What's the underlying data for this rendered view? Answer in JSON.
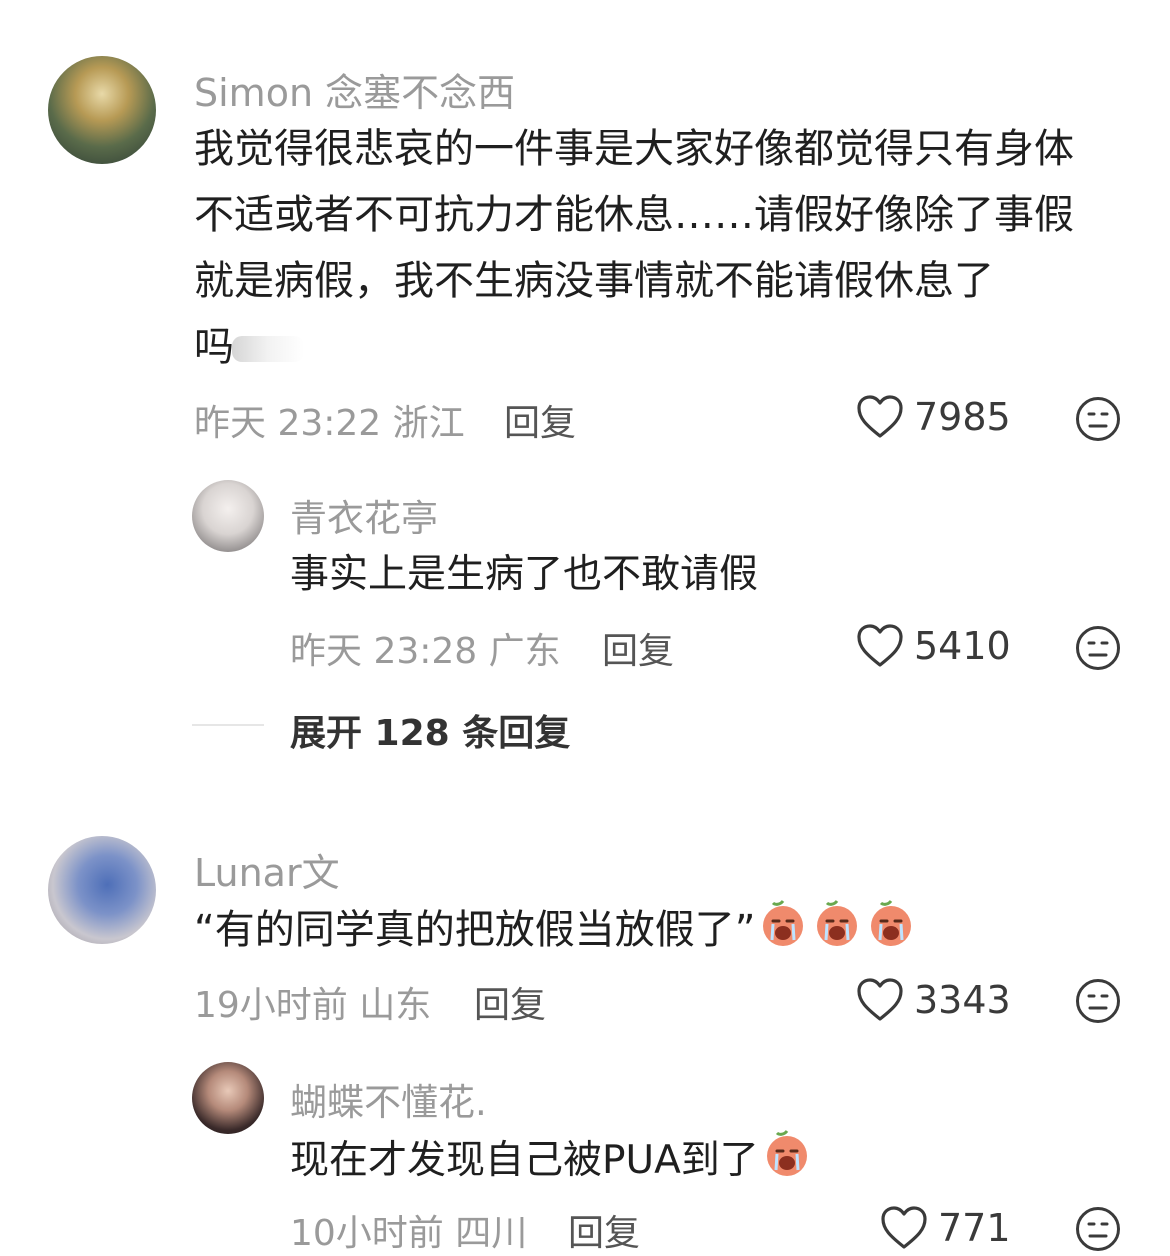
{
  "comments": [
    {
      "user": "Simon 念塞不念西",
      "lines": [
        "我觉得很悲哀的一件事是大家好像都觉得只有身体",
        "不适或者不可抗力才能休息……请假好像除了事假",
        "就是病假，我不生病没事情就不能请假休息了",
        "吗"
      ],
      "time_location": "昨天 23:22 浙江",
      "reply_label": "回复",
      "likes": "7985",
      "replies": [
        {
          "user": "青衣花亭",
          "text": "事实上是生病了也不敢请假",
          "time_location": "昨天 23:28 广东",
          "reply_label": "回复",
          "likes": "5410"
        }
      ],
      "expand_label": "展开 128 条回复"
    },
    {
      "user": "Lunar文",
      "text": "“有的同学真的把放假当放假了”",
      "time_location": "19小时前 山东",
      "reply_label": "回复",
      "likes": "3343",
      "replies": [
        {
          "user": "蝴蝶不懂花.",
          "text": "现在才发现自己被PUA到了",
          "time_location": "10小时前 四川",
          "reply_label": "回复",
          "likes": "771"
        }
      ]
    }
  ],
  "colors": {
    "meta": "#9a9a9a",
    "text": "#1f1f1f",
    "emoji_face": "#f08a6c"
  },
  "icons": {
    "like": "heart-outline-icon",
    "dislike": "neutral-face-icon",
    "emoji": "crying-peach-emoji"
  }
}
